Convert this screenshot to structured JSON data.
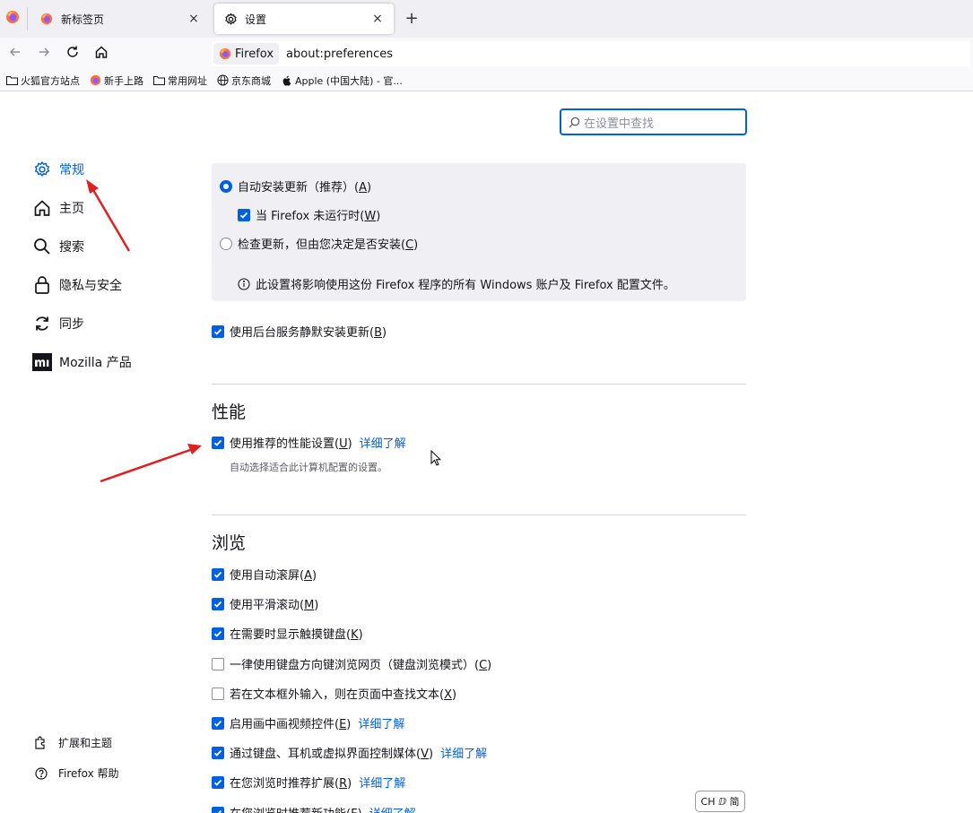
{
  "tabs": [
    {
      "label": "新标签页",
      "close": "×"
    },
    {
      "label": "设置",
      "close": "×"
    }
  ],
  "new_tab": "+",
  "urlbar": {
    "identity": "Firefox",
    "url": "about:preferences"
  },
  "bookmarks": [
    "火狐官方站点",
    "新手上路",
    "常用网址",
    "京东商城",
    "Apple (中国大陆) - 官..."
  ],
  "search": {
    "placeholder": "在设置中查找"
  },
  "sidebar": {
    "items": [
      "常规",
      "主页",
      "搜索",
      "隐私与安全",
      "同步",
      "Mozilla 产品"
    ],
    "footer": [
      "扩展和主题",
      "Firefox 帮助"
    ]
  },
  "updates": {
    "auto_install": "自动安装更新（推荐）(",
    "auto_install_key": "A",
    "when_closed": "当 Firefox 未运行时(",
    "when_closed_key": "W",
    "check_only": "检查更新，但由您决定是否安装(",
    "check_only_key": "C",
    "info": "此设置将影响使用这份 Firefox 程序的所有 Windows 账户及 Firefox 配置文件。",
    "background": "使用后台服务静默安装更新(",
    "background_key": "B"
  },
  "performance": {
    "heading": "性能",
    "recommended": "使用推荐的性能设置(",
    "recommended_key": "U",
    "learn_more": "详细了解",
    "description": "自动选择适合此计算机配置的设置。"
  },
  "browsing": {
    "heading": "浏览",
    "options": [
      {
        "label": "使用自动滚屏(",
        "key": "A",
        "checked": true,
        "link": ""
      },
      {
        "label": "使用平滑滚动(",
        "key": "M",
        "checked": true,
        "link": ""
      },
      {
        "label": "在需要时显示触摸键盘(",
        "key": "K",
        "checked": true,
        "link": ""
      },
      {
        "label": "一律使用键盘方向键浏览网页（键盘浏览模式）(",
        "key": "C",
        "checked": false,
        "link": ""
      },
      {
        "label": "若在文本框外输入，则在页面中查找文本(",
        "key": "X",
        "checked": false,
        "link": ""
      },
      {
        "label": "启用画中画视频控件(",
        "key": "E",
        "checked": true,
        "link": "详细了解"
      },
      {
        "label": "通过键盘、耳机或虚拟界面控制媒体(",
        "key": "V",
        "checked": true,
        "link": "详细了解"
      },
      {
        "label": "在您浏览时推荐扩展(",
        "key": "R",
        "checked": true,
        "link": "详细了解"
      },
      {
        "label": "在您浏览时推荐新功能(",
        "key": "F",
        "checked": true,
        "link": "详细了解"
      }
    ]
  },
  "ime": "CH ⅅ 简",
  "colors": {
    "accent": "#0061e0",
    "annotation": "#e02020"
  }
}
